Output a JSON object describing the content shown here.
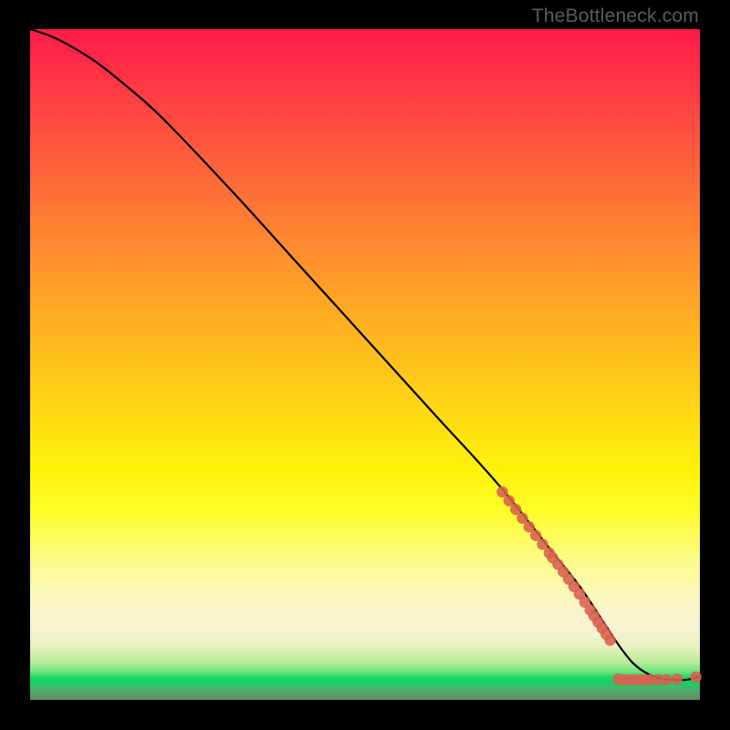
{
  "watermark": "TheBottleneck.com",
  "chart_data": {
    "type": "line",
    "title": "",
    "xlabel": "",
    "ylabel": "",
    "xlim": [
      0,
      100
    ],
    "ylim": [
      0,
      100
    ],
    "series": [
      {
        "name": "curve",
        "x": [
          0,
          3,
          6,
          10,
          15,
          20,
          30,
          40,
          50,
          60,
          70,
          78,
          82,
          86,
          88,
          90,
          92,
          94,
          96,
          98,
          100
        ],
        "y": [
          100,
          99,
          97.5,
          95,
          91,
          86.5,
          76,
          65,
          54,
          43,
          32,
          22,
          17,
          11,
          8,
          5.5,
          4,
          3.2,
          3,
          3,
          3.5
        ]
      }
    ],
    "color_gradient_stops": [
      {
        "pos": 0.0,
        "color": "#ff1a4b"
      },
      {
        "pos": 0.32,
        "color": "#ff8a30"
      },
      {
        "pos": 0.66,
        "color": "#fff30a"
      },
      {
        "pos": 0.89,
        "color": "#f8f2d6"
      },
      {
        "pos": 0.966,
        "color": "#23d766"
      },
      {
        "pos": 1.0,
        "color": "#628d64"
      }
    ],
    "scatter": {
      "name": "highlighted-points",
      "color": "#d9604f",
      "points": [
        {
          "x": 70.5,
          "y": 31
        },
        {
          "x": 71.5,
          "y": 29.7
        },
        {
          "x": 72.5,
          "y": 28.4
        },
        {
          "x": 73.5,
          "y": 27.1
        },
        {
          "x": 74.5,
          "y": 25.8
        },
        {
          "x": 75.5,
          "y": 24.5
        },
        {
          "x": 76.5,
          "y": 23.2
        },
        {
          "x": 77.5,
          "y": 21.9
        },
        {
          "x": 78.0,
          "y": 21.2
        },
        {
          "x": 78.8,
          "y": 20.2
        },
        {
          "x": 79.6,
          "y": 19.1
        },
        {
          "x": 80.4,
          "y": 18.0
        },
        {
          "x": 81.2,
          "y": 16.9
        },
        {
          "x": 82.0,
          "y": 15.8
        },
        {
          "x": 82.8,
          "y": 14.6
        },
        {
          "x": 83.6,
          "y": 13.4
        },
        {
          "x": 84.2,
          "y": 12.5
        },
        {
          "x": 84.8,
          "y": 11.6
        },
        {
          "x": 85.4,
          "y": 10.7
        },
        {
          "x": 86.0,
          "y": 9.8
        },
        {
          "x": 86.6,
          "y": 8.9
        },
        {
          "x": 87.8,
          "y": 3.1
        },
        {
          "x": 88.6,
          "y": 3.0
        },
        {
          "x": 89.4,
          "y": 3.0
        },
        {
          "x": 90.2,
          "y": 3.0
        },
        {
          "x": 91.0,
          "y": 3.0
        },
        {
          "x": 91.8,
          "y": 3.0
        },
        {
          "x": 92.6,
          "y": 3.0
        },
        {
          "x": 93.8,
          "y": 3.0
        },
        {
          "x": 95.0,
          "y": 3.0
        },
        {
          "x": 96.6,
          "y": 3.1
        },
        {
          "x": 99.4,
          "y": 3.4
        }
      ]
    }
  }
}
